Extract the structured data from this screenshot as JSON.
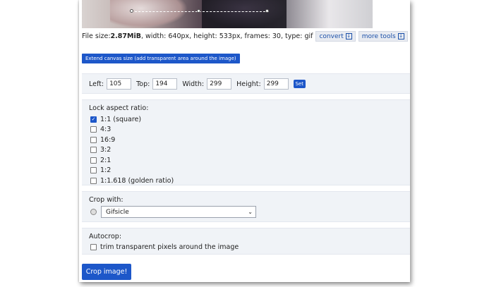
{
  "file_info": {
    "size_label": "File size: ",
    "size_value": "2.87MiB",
    "details": ", width: 640px, height: 533px, frames: 30, type: gif",
    "convert_label": "convert",
    "more_tools_label": "more tools"
  },
  "extend_button_label": "Extend canvas size (add transparent area around the image)",
  "dimensions": {
    "left_label": "Left:",
    "left_value": "105",
    "top_label": "Top:",
    "top_value": "194",
    "width_label": "Width:",
    "width_value": "299",
    "height_label": "Height:",
    "height_value": "299",
    "set_label": "Set"
  },
  "aspect": {
    "title": "Lock aspect ratio:",
    "options": [
      {
        "label": "1:1 (square)",
        "checked": true
      },
      {
        "label": "4:3",
        "checked": false
      },
      {
        "label": "16:9",
        "checked": false
      },
      {
        "label": "3:2",
        "checked": false
      },
      {
        "label": "2:1",
        "checked": false
      },
      {
        "label": "1:2",
        "checked": false
      },
      {
        "label": "1:1.618 (golden ratio)",
        "checked": false
      }
    ]
  },
  "crop_with": {
    "title": "Crop with:",
    "selected": "Gifsicle"
  },
  "autocrop": {
    "title": "Autocrop:",
    "option_label": "trim transparent pixels around the image"
  },
  "crop_button_label": "Crop image!",
  "colors": {
    "accent": "#1d57c9",
    "section_bg": "#f0f3f7"
  }
}
